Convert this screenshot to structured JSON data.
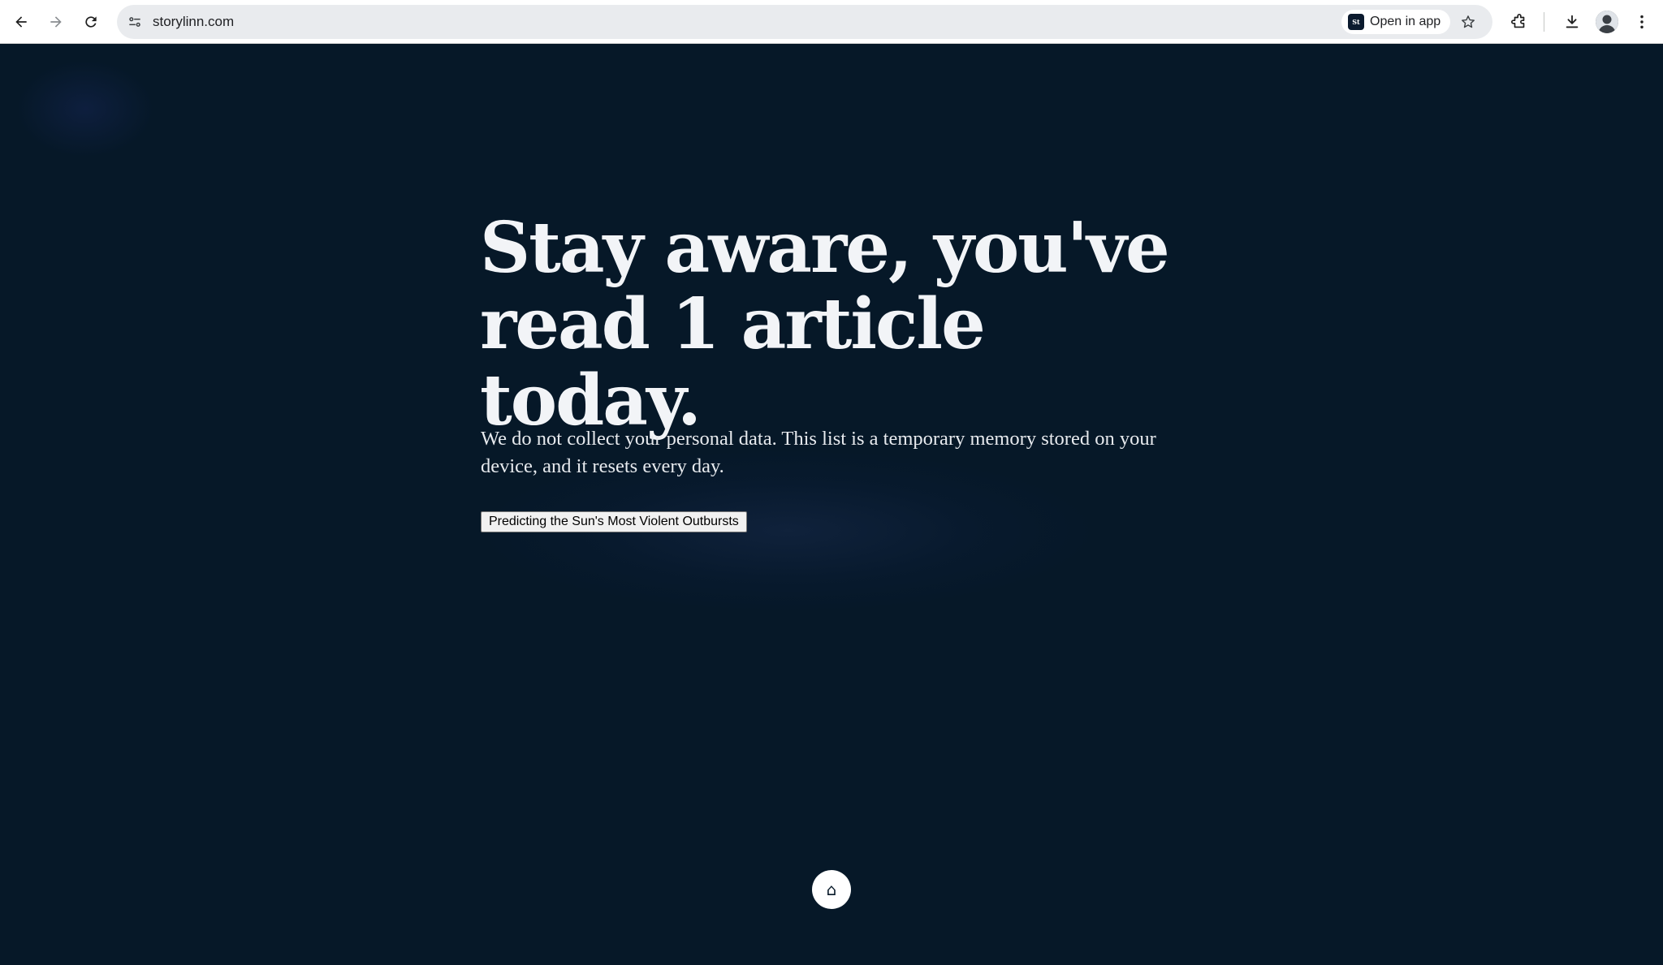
{
  "browser": {
    "url": "storylinn.com",
    "open_in_app_label": "Open in app",
    "app_badge_text": "St",
    "icons": {
      "back": "back-arrow-icon",
      "forward": "forward-arrow-icon",
      "reload": "reload-icon",
      "site_info": "site-settings-icon",
      "bookmark": "star-icon",
      "extensions": "puzzle-icon",
      "downloads": "download-icon",
      "profile": "avatar",
      "menu": "kebab-menu-icon"
    }
  },
  "page": {
    "headline": "Stay aware, you've read 1 article today.",
    "subtext": "We do not collect your personal data. This list is a temporary memory stored on your device, and it resets every day.",
    "articles": [
      {
        "title": "Predicting the Sun's Most Violent Outbursts"
      }
    ],
    "home_glyph": "⌂",
    "colors": {
      "background": "#061828",
      "headline": "#f2f4f7",
      "text": "#e7eaee"
    }
  }
}
